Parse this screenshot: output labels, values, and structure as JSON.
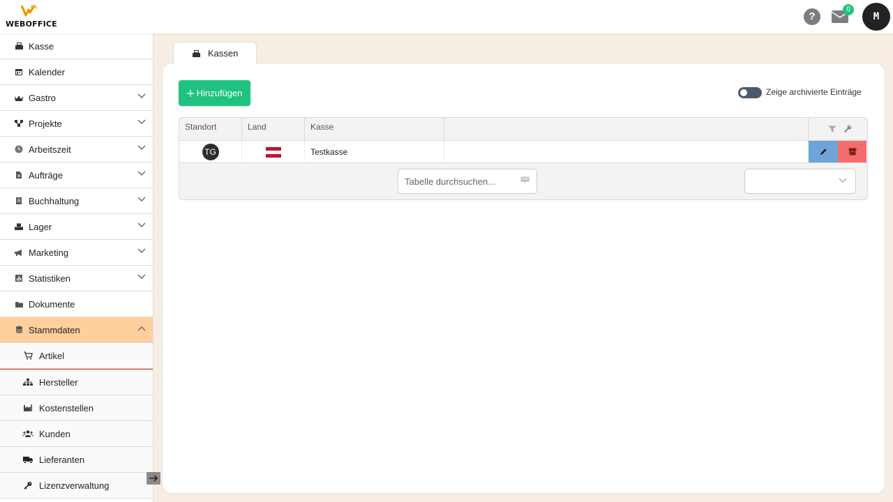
{
  "app": {
    "logo_text": "WEBOFFICE",
    "logo_color": "#f29100"
  },
  "header": {
    "help_label": "?",
    "mail_count": "0",
    "avatar_initial": "M"
  },
  "sidebar": {
    "items": [
      {
        "label": "Kasse",
        "icon": "cash-register-icon",
        "expandable": false
      },
      {
        "label": "Kalender",
        "icon": "calendar-icon",
        "expandable": false
      },
      {
        "label": "Gastro",
        "icon": "crown-icon",
        "expandable": true
      },
      {
        "label": "Projekte",
        "icon": "project-diagram-icon",
        "expandable": true
      },
      {
        "label": "Arbeitszeit",
        "icon": "clock-icon",
        "expandable": true
      },
      {
        "label": "Aufträge",
        "icon": "file-icon",
        "expandable": true
      },
      {
        "label": "Buchhaltung",
        "icon": "ledger-icon",
        "expandable": true
      },
      {
        "label": "Lager",
        "icon": "boxes-icon",
        "expandable": true
      },
      {
        "label": "Marketing",
        "icon": "megaphone-icon",
        "expandable": true
      },
      {
        "label": "Statistiken",
        "icon": "bar-chart-icon",
        "expandable": true
      },
      {
        "label": "Dokumente",
        "icon": "folder-icon",
        "expandable": false
      },
      {
        "label": "Stammdaten",
        "icon": "database-icon",
        "expandable": true,
        "active": true
      }
    ],
    "sub_items": [
      {
        "label": "Artikel",
        "icon": "cart-icon"
      },
      {
        "label": "Hersteller",
        "icon": "sitemap-icon"
      },
      {
        "label": "Kostenstellen",
        "icon": "industry-icon"
      },
      {
        "label": "Kunden",
        "icon": "users-icon"
      },
      {
        "label": "Lieferanten",
        "icon": "truck-icon"
      },
      {
        "label": "Lizenzverwaltung",
        "icon": "key-icon"
      }
    ]
  },
  "main": {
    "tab_label": "Kassen",
    "add_button_label": "Hinzufügen",
    "archive_toggle_label": "Zeige archivierte Einträge",
    "table": {
      "columns": [
        "Standort",
        "Land",
        "Kasse",
        ""
      ],
      "rows": [
        {
          "standort": "TG",
          "land": "AT",
          "kasse": "Testkasse"
        }
      ]
    },
    "search_placeholder": "Tabelle durchsuchen...",
    "page_size_value": ""
  },
  "colors": {
    "accent_green": "#1fc37f",
    "active_item": "#ffcf9e",
    "edit_blue": "#6ea5d8",
    "delete_red": "#f56c6c",
    "flag_red": "#c8102e"
  }
}
